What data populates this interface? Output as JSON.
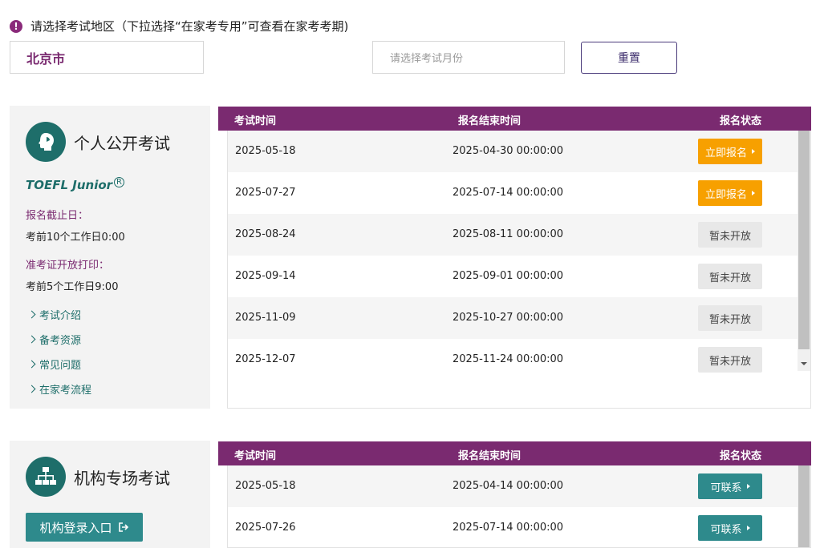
{
  "notice": {
    "text": "请选择考试地区（下拉选择“在家考专用”可查看在家考考期)"
  },
  "filters": {
    "region_value": "北京市",
    "month_placeholder": "请选择考试月份",
    "reset_label": "重置"
  },
  "columns": {
    "exam_time": "考试时间",
    "deadline": "报名结束时间",
    "status": "报名状态"
  },
  "public_exam": {
    "title": "个人公开考试",
    "brand": "TOEFL Junior",
    "brand_mark": "R",
    "deadline_label": "报名截止日：",
    "deadline_value": "考前10个工作日0:00",
    "print_label": "准考证开放打印：",
    "print_value": "考前5个工作日9:00",
    "links": [
      "考试介绍",
      "备考资源",
      "常见问题",
      "在家考流程"
    ],
    "rows": [
      {
        "date": "2025-05-18",
        "deadline": "2025-04-30 00:00:00",
        "status": "立即报名"
      },
      {
        "date": "2025-07-27",
        "deadline": "2025-07-14 00:00:00",
        "status": "立即报名"
      },
      {
        "date": "2025-08-24",
        "deadline": "2025-08-11 00:00:00",
        "status": "暂未开放"
      },
      {
        "date": "2025-09-14",
        "deadline": "2025-09-01 00:00:00",
        "status": "暂未开放"
      },
      {
        "date": "2025-11-09",
        "deadline": "2025-10-27 00:00:00",
        "status": "暂未开放"
      },
      {
        "date": "2025-12-07",
        "deadline": "2025-11-24 00:00:00",
        "status": "暂未开放"
      }
    ]
  },
  "org_exam": {
    "title": "机构专场考试",
    "login_label": "机构登录入口",
    "rows": [
      {
        "date": "2025-05-18",
        "deadline": "2025-04-14 00:00:00",
        "status": "可联系"
      },
      {
        "date": "2025-07-26",
        "deadline": "2025-07-14 00:00:00",
        "status": "可联系"
      }
    ]
  },
  "colors": {
    "brand_purple": "#7a2a70",
    "teal": "#1e6e6a",
    "orange": "#f7a000",
    "button_teal": "#2e8a8c"
  }
}
